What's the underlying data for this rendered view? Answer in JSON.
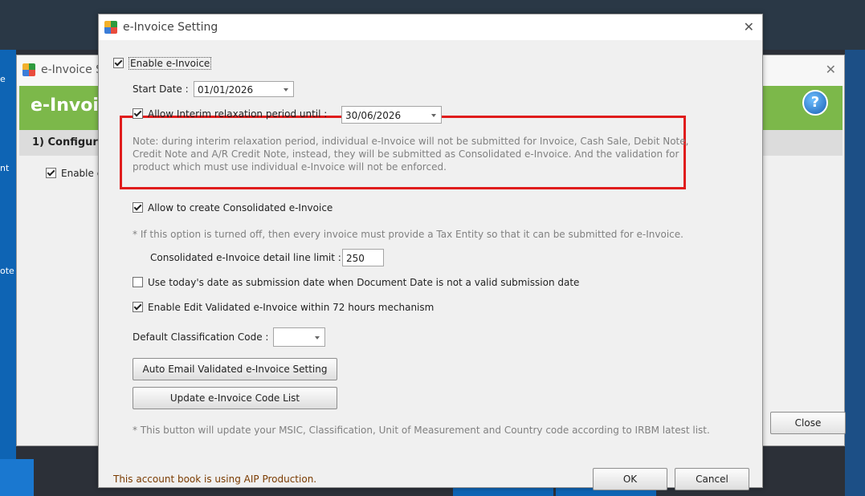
{
  "back_window": {
    "title": "e-Invoice S",
    "banner": "e-Invoi",
    "section": "1) Configure",
    "enable_label": "Enable e",
    "close_button": "Close",
    "left_labels": [
      "e",
      "nt",
      "ote"
    ]
  },
  "dialog": {
    "title": "e-Invoice Setting",
    "enable_einvoice": {
      "label": "Enable e-Invoice",
      "checked": true
    },
    "start_date": {
      "label": "Start Date :",
      "value": "01/01/2026"
    },
    "interim": {
      "label": "Allow Interim relaxation period until :",
      "checked": true,
      "value": "30/06/2026",
      "note": [
        "Note: during interim relaxation period, individual e-Invoice will not be submitted for Invoice, Cash Sale, Debit Note,",
        "Credit Note and A/R Credit Note, instead, they will be submitted as Consolidated e-Invoice. And the validation for",
        "product which must use individual e-Invoice will not be enforced."
      ]
    },
    "consolidated": {
      "label": "Allow to create Consolidated e-Invoice",
      "checked": true,
      "note": "* If this option is turned off, then every invoice must provide a Tax Entity so that it can be submitted for e-Invoice.",
      "limit_label": "Consolidated e-Invoice detail line limit :",
      "limit_value": "250"
    },
    "todays_date": {
      "label": "Use today's date as submission date when Document Date is not a valid submission date",
      "checked": false
    },
    "edit_validated": {
      "label": "Enable Edit Validated e-Invoice within 72 hours mechanism",
      "checked": true
    },
    "classification": {
      "label": "Default Classification Code :",
      "value": ""
    },
    "auto_email_button": "Auto Email Validated e-Invoice Setting",
    "update_code_button": "Update e-Invoice Code List",
    "update_note": "* This button will update your MSIC, Classification, Unit of Measurement and Country code according to IRBM latest list.",
    "status_text": "This account book is using AIP Production.",
    "ok_button": "OK",
    "cancel_button": "Cancel"
  },
  "colors": {
    "highlight_box": "#e01c1c",
    "banner_green": "#7cb84a",
    "status_text": "#7a3b00"
  }
}
